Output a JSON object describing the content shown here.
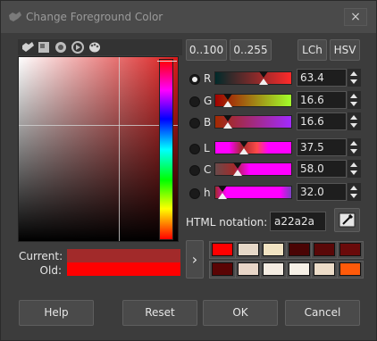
{
  "window": {
    "title": "Change Foreground Color",
    "close_icon": "×"
  },
  "tabs": [
    {
      "name": "gimp-selector-icon"
    },
    {
      "name": "cmyk-selector-icon"
    },
    {
      "name": "wheel-selector-icon"
    },
    {
      "name": "triangle-selector-icon"
    },
    {
      "name": "palette-selector-icon"
    }
  ],
  "range": {
    "btn_100": "0..100",
    "btn_255": "0..255"
  },
  "model": {
    "lch": "LCh",
    "hsv": "HSV"
  },
  "channels": [
    {
      "label": "R",
      "value": "63.4",
      "checked": true,
      "fraction": 0.634
    },
    {
      "label": "G",
      "value": "16.6",
      "checked": false,
      "fraction": 0.166
    },
    {
      "label": "B",
      "value": "16.6",
      "checked": false,
      "fraction": 0.166
    },
    {
      "label": "L",
      "value": "37.5",
      "checked": false,
      "fraction": 0.375
    },
    {
      "label": "C",
      "value": "58.0",
      "checked": false,
      "fraction": 0.29
    },
    {
      "label": "h",
      "value": "32.0",
      "checked": false,
      "fraction": 0.089
    }
  ],
  "html_notation": {
    "label": "HTML notation:",
    "value": "a22a2a"
  },
  "current": {
    "label": "Current:",
    "color": "#a22a2a"
  },
  "old": {
    "label": "Old:",
    "color": "#ff0000"
  },
  "history_arrow": "›",
  "history": [
    "#ff0000",
    "#e6d8c8",
    "#f1e3c2",
    "#4a0404",
    "#5a0808",
    "#6a0a0a",
    "#5a0404",
    "#e8d6c8",
    "#f4ece2",
    "#f6f0e6",
    "#ecdcc8",
    "#ff5a0a"
  ],
  "buttons": {
    "help": "Help",
    "reset": "Reset",
    "ok": "OK",
    "cancel": "Cancel"
  }
}
